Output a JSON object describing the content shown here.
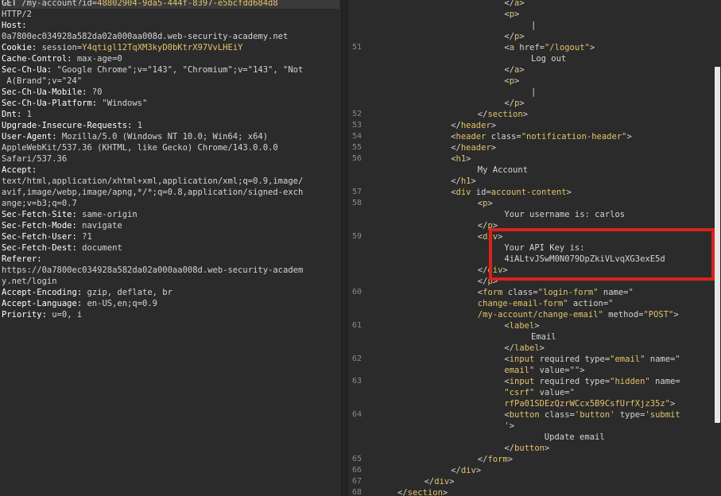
{
  "request": {
    "method": "GET",
    "path": "/my-account?id=",
    "id_value": "48802904-9da5-444f-8397-e5bcfdd684d8",
    "protocol": "HTTP/2",
    "headers": [
      {
        "name": "Host:",
        "value": ""
      },
      {
        "name": "",
        "value": "0a7800ec034928a582da02a000aa008d.web-security-academy.net"
      },
      {
        "name": "Cookie:",
        "value": " session=",
        "hl": "Y4qtigl12TqXM3kyD0bKtrX97VvLHEiY"
      },
      {
        "name": "Cache-Control:",
        "value": " max-age=0"
      },
      {
        "name": "Sec-Ch-Ua:",
        "value": " \"Google Chrome\";v=\"143\", \"Chromium\";v=\"143\", \"Not"
      },
      {
        "name": "",
        "value": " A(Brand\";v=\"24\""
      },
      {
        "name": "Sec-Ch-Ua-Mobile:",
        "value": " ?0"
      },
      {
        "name": "Sec-Ch-Ua-Platform:",
        "value": " \"Windows\""
      },
      {
        "name": "Dnt:",
        "value": " 1"
      },
      {
        "name": "Upgrade-Insecure-Requests:",
        "value": " 1"
      },
      {
        "name": "User-Agent:",
        "value": " Mozilla/5.0 (Windows NT 10.0; Win64; x64)"
      },
      {
        "name": "",
        "value": "AppleWebKit/537.36 (KHTML, like Gecko) Chrome/143.0.0.0"
      },
      {
        "name": "",
        "value": "Safari/537.36"
      },
      {
        "name": "Accept:",
        "value": ""
      },
      {
        "name": "",
        "value": "text/html,application/xhtml+xml,application/xml;q=0.9,image/"
      },
      {
        "name": "",
        "value": "avif,image/webp,image/apng,*/*;q=0.8,application/signed-exch"
      },
      {
        "name": "",
        "value": "ange;v=b3;q=0.7"
      },
      {
        "name": "Sec-Fetch-Site:",
        "value": " same-origin"
      },
      {
        "name": "Sec-Fetch-Mode:",
        "value": " navigate"
      },
      {
        "name": "Sec-Fetch-User:",
        "value": " ?1"
      },
      {
        "name": "Sec-Fetch-Dest:",
        "value": " document"
      },
      {
        "name": "Referer:",
        "value": ""
      },
      {
        "name": "",
        "value": "https://0a7800ec034928a582da02a000aa008d.web-security-academ"
      },
      {
        "name": "",
        "value": "y.net/login"
      },
      {
        "name": "Accept-Encoding:",
        "value": " gzip, deflate, br"
      },
      {
        "name": "Accept-Language:",
        "value": " en-US,en;q=0.9"
      },
      {
        "name": "Priority:",
        "value": " u=0, i"
      }
    ]
  },
  "response": {
    "lines": [
      {
        "ln": "",
        "indent": 16,
        "parts": [
          [
            "br",
            "</"
          ],
          [
            "tag",
            "a"
          ],
          [
            "br",
            ">"
          ]
        ]
      },
      {
        "ln": "",
        "indent": 16,
        "parts": [
          [
            "br",
            "<"
          ],
          [
            "tag",
            "p"
          ],
          [
            "br",
            ">"
          ]
        ]
      },
      {
        "ln": "",
        "indent": 20,
        "parts": [
          [
            "txt",
            "|"
          ]
        ]
      },
      {
        "ln": "",
        "indent": 16,
        "parts": [
          [
            "br",
            "</"
          ],
          [
            "tag",
            "p"
          ],
          [
            "br",
            ">"
          ]
        ]
      },
      {
        "ln": "51",
        "indent": 16,
        "parts": [
          [
            "br",
            "<"
          ],
          [
            "tag",
            "a"
          ],
          [
            "attr",
            " href="
          ],
          [
            "str",
            "\"/logout\""
          ],
          [
            "br",
            ">"
          ]
        ]
      },
      {
        "ln": "",
        "indent": 20,
        "parts": [
          [
            "txt",
            "Log out"
          ]
        ]
      },
      {
        "ln": "",
        "indent": 16,
        "parts": [
          [
            "br",
            "</"
          ],
          [
            "tag",
            "a"
          ],
          [
            "br",
            ">"
          ]
        ]
      },
      {
        "ln": "",
        "indent": 16,
        "parts": [
          [
            "br",
            "<"
          ],
          [
            "tag",
            "p"
          ],
          [
            "br",
            ">"
          ]
        ]
      },
      {
        "ln": "",
        "indent": 20,
        "parts": [
          [
            "txt",
            "|"
          ]
        ]
      },
      {
        "ln": "",
        "indent": 16,
        "parts": [
          [
            "br",
            "</"
          ],
          [
            "tag",
            "p"
          ],
          [
            "br",
            ">"
          ]
        ]
      },
      {
        "ln": "52",
        "indent": 12,
        "parts": [
          [
            "br",
            "</"
          ],
          [
            "tag",
            "section"
          ],
          [
            "br",
            ">"
          ]
        ]
      },
      {
        "ln": "53",
        "indent": 8,
        "parts": [
          [
            "br",
            "</"
          ],
          [
            "tag",
            "header"
          ],
          [
            "br",
            ">"
          ]
        ]
      },
      {
        "ln": "54",
        "indent": 8,
        "parts": [
          [
            "br",
            "<"
          ],
          [
            "tag",
            "header"
          ],
          [
            "attr",
            " class="
          ],
          [
            "str",
            "\"notification-header\""
          ],
          [
            "br",
            ">"
          ]
        ]
      },
      {
        "ln": "55",
        "indent": 8,
        "parts": [
          [
            "br",
            "</"
          ],
          [
            "tag",
            "header"
          ],
          [
            "br",
            ">"
          ]
        ]
      },
      {
        "ln": "56",
        "indent": 8,
        "parts": [
          [
            "br",
            "<"
          ],
          [
            "tag",
            "h1"
          ],
          [
            "br",
            ">"
          ]
        ]
      },
      {
        "ln": "",
        "indent": 12,
        "parts": [
          [
            "txt",
            "My Account"
          ]
        ]
      },
      {
        "ln": "",
        "indent": 8,
        "parts": [
          [
            "br",
            "</"
          ],
          [
            "tag",
            "h1"
          ],
          [
            "br",
            ">"
          ]
        ]
      },
      {
        "ln": "57",
        "indent": 8,
        "parts": [
          [
            "br",
            "<"
          ],
          [
            "tag",
            "div"
          ],
          [
            "attr",
            " id="
          ],
          [
            "str",
            "account-content"
          ],
          [
            "br",
            ">"
          ]
        ]
      },
      {
        "ln": "58",
        "indent": 12,
        "parts": [
          [
            "br",
            "<"
          ],
          [
            "tag",
            "p"
          ],
          [
            "br",
            ">"
          ]
        ]
      },
      {
        "ln": "",
        "indent": 16,
        "parts": [
          [
            "txt",
            "Your username is: carlos"
          ]
        ]
      },
      {
        "ln": "",
        "indent": 12,
        "parts": [
          [
            "br",
            "</"
          ],
          [
            "tag",
            "p"
          ],
          [
            "br",
            ">"
          ]
        ]
      },
      {
        "ln": "59",
        "indent": 12,
        "parts": [
          [
            "br",
            "<"
          ],
          [
            "tag",
            "div"
          ],
          [
            "br",
            ">"
          ]
        ]
      },
      {
        "ln": "",
        "indent": 16,
        "parts": [
          [
            "txt",
            "Your API Key is:"
          ]
        ]
      },
      {
        "ln": "",
        "indent": 16,
        "parts": [
          [
            "txt",
            "4iALtvJSwM0N079DpZkiVLvqXG3exE5d"
          ]
        ]
      },
      {
        "ln": "",
        "indent": 12,
        "parts": [
          [
            "br",
            "</"
          ],
          [
            "tag",
            "div"
          ],
          [
            "br",
            ">"
          ]
        ]
      },
      {
        "ln": "",
        "indent": 12,
        "parts": [
          [
            "br",
            "</"
          ],
          [
            "tag",
            "p"
          ],
          [
            "br",
            ">"
          ]
        ]
      },
      {
        "ln": "60",
        "indent": 12,
        "parts": [
          [
            "br",
            "<"
          ],
          [
            "tag",
            "form"
          ],
          [
            "attr",
            " class="
          ],
          [
            "str",
            "\"login-form\""
          ],
          [
            "attr",
            " name="
          ],
          [
            "str",
            "\""
          ]
        ]
      },
      {
        "ln": "",
        "indent": 12,
        "parts": [
          [
            "str",
            "change-email-form\""
          ],
          [
            "attr",
            " action="
          ],
          [
            "str",
            "\""
          ]
        ]
      },
      {
        "ln": "",
        "indent": 12,
        "parts": [
          [
            "str",
            "/my-account/change-email\""
          ],
          [
            "attr",
            " method="
          ],
          [
            "str",
            "\"POST\""
          ],
          [
            "br",
            ">"
          ]
        ]
      },
      {
        "ln": "61",
        "indent": 16,
        "parts": [
          [
            "br",
            "<"
          ],
          [
            "tag",
            "label"
          ],
          [
            "br",
            ">"
          ]
        ]
      },
      {
        "ln": "",
        "indent": 20,
        "parts": [
          [
            "txt",
            "Email"
          ]
        ]
      },
      {
        "ln": "",
        "indent": 16,
        "parts": [
          [
            "br",
            "</"
          ],
          [
            "tag",
            "label"
          ],
          [
            "br",
            ">"
          ]
        ]
      },
      {
        "ln": "62",
        "indent": 16,
        "parts": [
          [
            "br",
            "<"
          ],
          [
            "tag",
            "input"
          ],
          [
            "attr",
            " required type="
          ],
          [
            "str",
            "\"email\""
          ],
          [
            "attr",
            " name="
          ],
          [
            "str",
            "\""
          ]
        ]
      },
      {
        "ln": "",
        "indent": 16,
        "parts": [
          [
            "str",
            "email\""
          ],
          [
            "attr",
            " value="
          ],
          [
            "str",
            "\"\""
          ],
          [
            "br",
            ">"
          ]
        ]
      },
      {
        "ln": "63",
        "indent": 16,
        "parts": [
          [
            "br",
            "<"
          ],
          [
            "tag",
            "input"
          ],
          [
            "attr",
            " required type="
          ],
          [
            "str",
            "\"hidden\""
          ],
          [
            "attr",
            " name="
          ]
        ]
      },
      {
        "ln": "",
        "indent": 16,
        "parts": [
          [
            "str",
            "\"csrf\""
          ],
          [
            "attr",
            " value="
          ],
          [
            "str",
            "\""
          ]
        ]
      },
      {
        "ln": "",
        "indent": 16,
        "parts": [
          [
            "str",
            "rfPa01SDEzQzrWCcx5B9CsfUrfXjz35z\""
          ],
          [
            "br",
            ">"
          ]
        ]
      },
      {
        "ln": "64",
        "indent": 16,
        "parts": [
          [
            "br",
            "<"
          ],
          [
            "tag",
            "button"
          ],
          [
            "attr",
            " class="
          ],
          [
            "str",
            "'button'"
          ],
          [
            "attr",
            " type="
          ],
          [
            "str",
            "'submit"
          ]
        ]
      },
      {
        "ln": "",
        "indent": 16,
        "parts": [
          [
            "str",
            "'"
          ],
          [
            "br",
            ">"
          ]
        ]
      },
      {
        "ln": "",
        "indent": 22,
        "parts": [
          [
            "txt",
            "Update email"
          ]
        ]
      },
      {
        "ln": "",
        "indent": 16,
        "parts": [
          [
            "br",
            "</"
          ],
          [
            "tag",
            "button"
          ],
          [
            "br",
            ">"
          ]
        ]
      },
      {
        "ln": "65",
        "indent": 12,
        "parts": [
          [
            "br",
            "</"
          ],
          [
            "tag",
            "form"
          ],
          [
            "br",
            ">"
          ]
        ]
      },
      {
        "ln": "66",
        "indent": 8,
        "parts": [
          [
            "br",
            "</"
          ],
          [
            "tag",
            "div"
          ],
          [
            "br",
            ">"
          ]
        ]
      },
      {
        "ln": "67",
        "indent": 4,
        "parts": [
          [
            "br",
            "</"
          ],
          [
            "tag",
            "div"
          ],
          [
            "br",
            ">"
          ]
        ]
      },
      {
        "ln": "68",
        "indent": 0,
        "parts": [
          [
            "br",
            "</"
          ],
          [
            "tag",
            "section"
          ],
          [
            "br",
            ">"
          ]
        ]
      }
    ]
  },
  "colors": {
    "highlight_box": "#d9221c",
    "token": "#e3c46a",
    "background": "#2b2b2b"
  }
}
